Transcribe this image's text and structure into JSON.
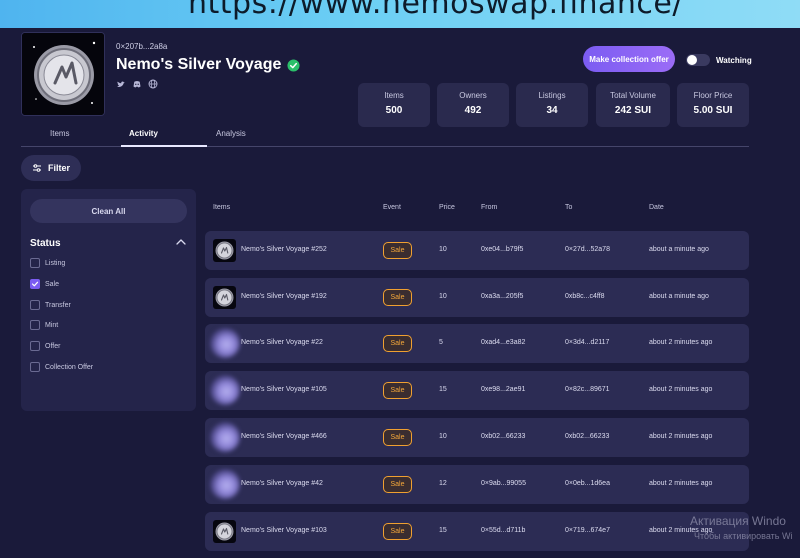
{
  "banner": {
    "url": "https://www.nemoswap.finance/"
  },
  "collection": {
    "address": "0×207b...2a8a",
    "name": "Nemo's Silver Voyage",
    "make_offer_label": "Make collection offer",
    "watching_label": "Watching"
  },
  "stats": [
    {
      "label": "Items",
      "value": "500"
    },
    {
      "label": "Owners",
      "value": "492"
    },
    {
      "label": "Listings",
      "value": "34"
    },
    {
      "label": "Total Volume",
      "value": "242 SUI"
    },
    {
      "label": "Floor Price",
      "value": "5.00 SUI"
    }
  ],
  "tabs": [
    {
      "label": "Items"
    },
    {
      "label": "Activity"
    },
    {
      "label": "Analysis"
    }
  ],
  "filter_label": "Filter",
  "sidebar": {
    "clear_label": "Clean All",
    "status_title": "Status",
    "options": [
      {
        "label": "Listing",
        "checked": false
      },
      {
        "label": "Sale",
        "checked": true
      },
      {
        "label": "Transfer",
        "checked": false
      },
      {
        "label": "Mint",
        "checked": false
      },
      {
        "label": "Offer",
        "checked": false
      },
      {
        "label": "Collection Offer",
        "checked": false
      }
    ]
  },
  "table": {
    "headers": [
      "Items",
      "Event",
      "Price",
      "From",
      "To",
      "Date"
    ],
    "rows": [
      {
        "item": "Nemo's Silver Voyage #252",
        "event": "Sale",
        "price": "10",
        "from": "0xe04...b79f5",
        "to": "0×27d...52a78",
        "date": "about a minute ago",
        "thumb": "coin"
      },
      {
        "item": "Nemo's Silver Voyage #192",
        "event": "Sale",
        "price": "10",
        "from": "0xa3a...205f5",
        "to": "0xb8c...c4ff8",
        "date": "about a minute ago",
        "thumb": "coin"
      },
      {
        "item": "Nemo's Silver Voyage #22",
        "event": "Sale",
        "price": "5",
        "from": "0xad4...e3a82",
        "to": "0×3d4...d2117",
        "date": "about 2 minutes ago",
        "thumb": "blur"
      },
      {
        "item": "Nemo's Silver Voyage #105",
        "event": "Sale",
        "price": "15",
        "from": "0xe98...2ae91",
        "to": "0×82c...89671",
        "date": "about 2 minutes ago",
        "thumb": "blur"
      },
      {
        "item": "Nemo's Silver Voyage #466",
        "event": "Sale",
        "price": "10",
        "from": "0xb02...66233",
        "to": "0xb02...66233",
        "date": "about 2 minutes ago",
        "thumb": "blur"
      },
      {
        "item": "Nemo's Silver Voyage #42",
        "event": "Sale",
        "price": "12",
        "from": "0×9ab...99055",
        "to": "0×0eb...1d6ea",
        "date": "about 2 minutes ago",
        "thumb": "blur"
      },
      {
        "item": "Nemo's Silver Voyage #103",
        "event": "Sale",
        "price": "15",
        "from": "0×55d...d711b",
        "to": "0×719...674e7",
        "date": "about 2 minutes ago",
        "thumb": "coin"
      }
    ]
  },
  "os_watermark": {
    "line1": "Активация Windo",
    "line2": "Чтобы активировать Wi"
  }
}
